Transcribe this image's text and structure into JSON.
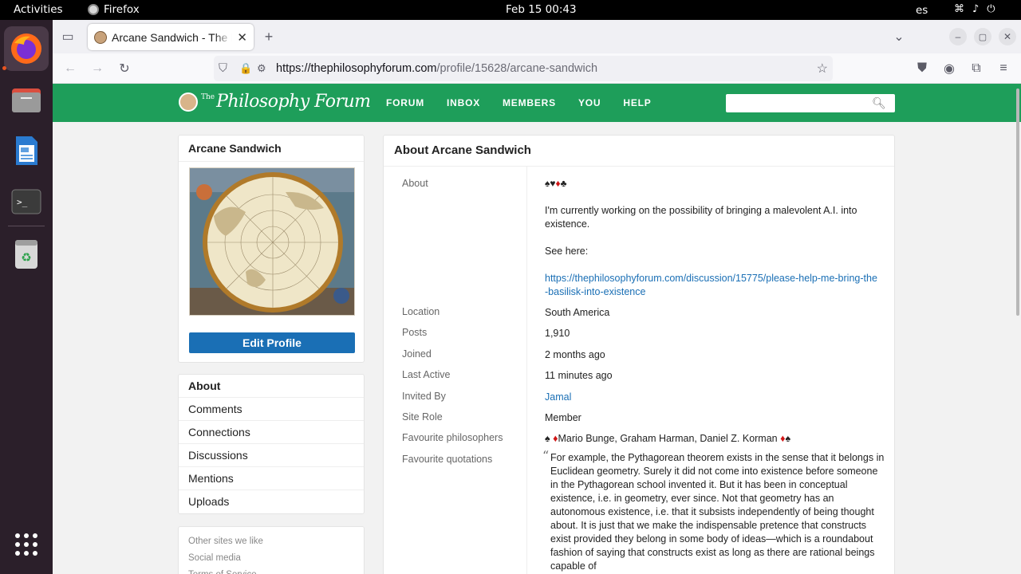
{
  "system": {
    "activities": "Activities",
    "app_name": "Firefox",
    "clock": "Feb 15  00:43",
    "lang": "es"
  },
  "browser": {
    "tab_title": "Arcane Sandwich - The Philosophy Forum",
    "url_domain": "https://thephilosophyforum.com",
    "url_path": "/profile/15628/arcane-sandwich"
  },
  "site": {
    "logo_the": "The",
    "logo_name": "Philosophy Forum",
    "nav": [
      "FORUM",
      "INBOX",
      "MEMBERS",
      "YOU",
      "HELP"
    ],
    "search_value": ""
  },
  "profile": {
    "name": "Arcane Sandwich",
    "edit_button": "Edit Profile",
    "menu": [
      "About",
      "Comments",
      "Connections",
      "Discussions",
      "Mentions",
      "Uploads"
    ],
    "footer_links": [
      "Other sites we like",
      "Social media",
      "Terms of Service"
    ]
  },
  "about": {
    "heading": "About Arcane Sandwich",
    "about_label": "About",
    "about_suits": [
      "♠",
      "♥",
      "♦",
      "♣"
    ],
    "about_text_1": "I'm currently working on the possibility of bringing a malevolent A.I. into existence.",
    "about_text_2": "See here:",
    "about_link": "https://thephilosophyforum.com/discussion/15775/please-help-me-bring-the-basilisk-into-existence",
    "fields": [
      {
        "label": "Location",
        "value": "South America"
      },
      {
        "label": "Posts",
        "value": "1,910"
      },
      {
        "label": "Joined",
        "value": "2 months ago"
      },
      {
        "label": "Last Active",
        "value": "11 minutes ago"
      },
      {
        "label": "Invited By",
        "value": "Jamal"
      },
      {
        "label": "Site Role",
        "value": "Member"
      }
    ],
    "philosophers_label": "Favourite philosophers",
    "philosophers_value": "Mario Bunge, Graham Harman, Daniel Z. Korman",
    "quotations_label": "Favourite quotations",
    "quotation": "For example, the Pythagorean theorem exists in the sense that it belongs in Euclidean geometry. Surely it did not come into existence before someone in the Pythagorean school invented it. But it has been in conceptual existence, i.e. in geometry, ever since. Not that geometry has an autonomous existence, i.e. that it subsists independently of being thought about. It is just that we make the indispensable pretence that constructs exist provided they belong in some body of ideas—which is a roundabout fashion of saying that constructs exist as long as there are rational beings capable of"
  },
  "colors": {
    "site_green": "#1e9e5a",
    "link_blue": "#1a6fb5",
    "button_blue": "#1a6fb5",
    "suit_red": "#d01616"
  }
}
